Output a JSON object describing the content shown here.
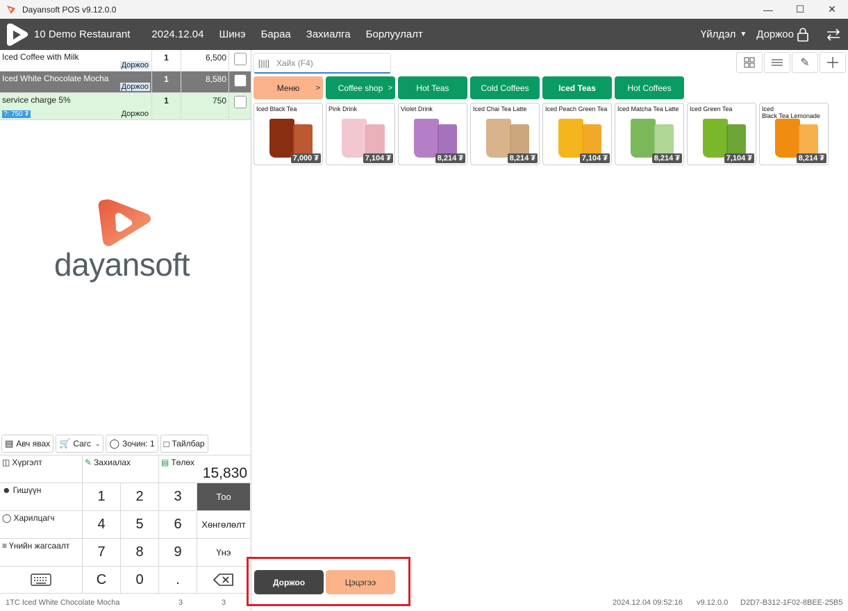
{
  "window": {
    "title": "Dayansoft POS v9.12.0.0",
    "controls": [
      "—",
      "☐",
      "✕"
    ]
  },
  "topbar": {
    "restaurant": "10 Demo Restaurant",
    "date": "2024.12.04",
    "status": "Шинэ",
    "nav": [
      "Бараа",
      "Захиалга",
      "Борлуулалт"
    ],
    "operation": "Үйлдэл",
    "order_lock": "Доржоо"
  },
  "orders": [
    {
      "name": "Iced Coffee with Milk",
      "tag": "Доржоо",
      "qty": "1",
      "price": "6,500"
    },
    {
      "name": "Iced White Chocolate Mocha",
      "tag": "Доржоо",
      "qty": "1",
      "price": "8,580"
    },
    {
      "name": "service charge 5%",
      "tag": "Доржоо",
      "charge": "?: 750 ₮",
      "qty": "1",
      "price": "750"
    }
  ],
  "logo_text": "dayansoft",
  "tools": {
    "takeaway": "Авч явах",
    "cart": "Сагс",
    "guests": "Зочин: 1",
    "note": "Тайлбар"
  },
  "pad": {
    "delivery": "Хүргэлт",
    "order": "Захиалах",
    "pay": "Төлөх",
    "total": "15,830",
    "member": "Гишүүн",
    "customer": "Харилцагч",
    "price_list": "Үнийн жагсаалт",
    "keys": [
      "1",
      "2",
      "3",
      "4",
      "5",
      "6",
      "7",
      "8",
      "9",
      "C",
      "0",
      "."
    ],
    "qty_mode": "Тоо",
    "discount": "Хөнгөлөлт",
    "price": "Үнэ"
  },
  "search": {
    "placeholder": "Хайх (F4)"
  },
  "categories": [
    {
      "label": "Меню",
      "arrow": ">"
    },
    {
      "label": "Coffee shop",
      "arrow": ">"
    },
    {
      "label": "Hot Teas"
    },
    {
      "label": "Cold Coffees"
    },
    {
      "label": "Iced Teas"
    },
    {
      "label": "Hot Coffees"
    }
  ],
  "products": [
    {
      "name": "Iced Black Tea",
      "price": "7,000 ₮",
      "color": "#8a2e12",
      "color2": "#b5461c"
    },
    {
      "name": "Pink Drink",
      "price": "7,104 ₮",
      "color": "#f2c7cf",
      "color2": "#e8a9b4"
    },
    {
      "name": "Violet Drink",
      "price": "8,214 ₮",
      "color": "#b57fc8",
      "color2": "#9b63b5"
    },
    {
      "name": "Iced Chai Tea Latte",
      "price": "8,214 ₮",
      "color": "#d9b38c",
      "color2": "#c79c6e"
    },
    {
      "name": "Iced Peach Green Tea",
      "price": "7,104 ₮",
      "color": "#f5b51c",
      "color2": "#f0a010"
    },
    {
      "name": "Iced Matcha Tea Latte",
      "price": "8,214 ₮",
      "color": "#7bb85a",
      "color2": "#a6d28a"
    },
    {
      "name": "Iced Green Tea",
      "price": "7,104 ₮",
      "color": "#7ab82a",
      "color2": "#5c9a20"
    },
    {
      "name": "Iced\nBlack Tea Lemonade",
      "price": "8,214 ₮",
      "color": "#f08c10",
      "color2": "#f5a83a"
    }
  ],
  "actions": {
    "save": "Доржоо",
    "clear": "Цэцэгээ"
  },
  "statusbar": {
    "item": "1TC Iced White Chocolate Mocha",
    "n1": "3",
    "n2": "3",
    "datetime": "2024.12.04 09:52:16",
    "version": "v9.12.0.0",
    "device": "D2D7-B312-1F02-8BEE-25B5"
  }
}
